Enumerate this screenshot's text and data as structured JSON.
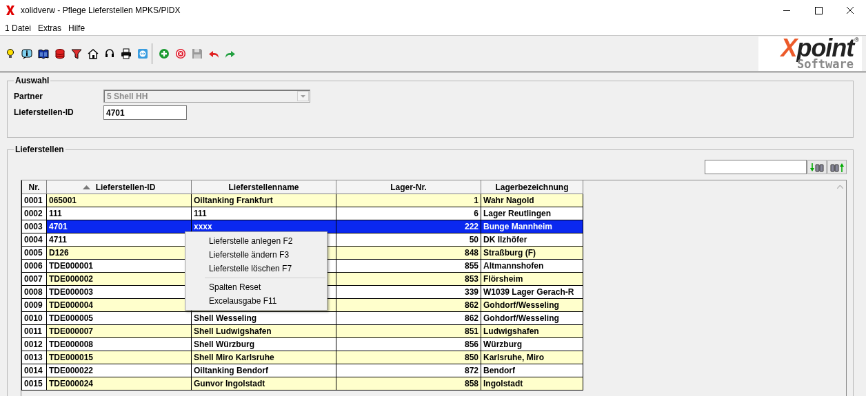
{
  "window": {
    "title": "xolidverw - Pflege Lieferstellen MPKS/PIDX"
  },
  "menu": [
    "1 Datei",
    "Extras",
    "Hilfe"
  ],
  "logo": {
    "text": "Xpoint",
    "subtext": "Software",
    "mark": "®"
  },
  "selection": {
    "title": "Auswahl",
    "partner_label": "Partner",
    "partner_value": "5  Shell HH",
    "partner_disabled": true,
    "id_label": "Lieferstellen-ID",
    "id_value": "4701"
  },
  "list": {
    "title": "Lieferstellen"
  },
  "table": {
    "columns": [
      {
        "label": "Nr.",
        "sorted": false
      },
      {
        "label": "Lieferstellen-ID",
        "sorted": true
      },
      {
        "label": "Lieferstellenname",
        "sorted": false
      },
      {
        "label": "Lager-Nr.",
        "sorted": false
      },
      {
        "label": "Lagerbezeichnung",
        "sorted": false
      }
    ],
    "rows": [
      {
        "selected": false,
        "cells": [
          "0001",
          "065001",
          "Oiltanking Frankfurt",
          "1",
          "Wahr Nagold"
        ]
      },
      {
        "selected": false,
        "cells": [
          "0002",
          "111",
          "111",
          "6",
          "Lager Reutlingen"
        ]
      },
      {
        "selected": true,
        "cells": [
          "0003",
          "4701",
          "xxxx",
          "222",
          "Bunge Mannheim"
        ]
      },
      {
        "selected": false,
        "cells": [
          "0004",
          "4711",
          null,
          "50",
          "DK Ilzhöfer"
        ]
      },
      {
        "selected": false,
        "cells": [
          "0005",
          "D126",
          null,
          "848",
          "Straßburg (F)"
        ]
      },
      {
        "selected": false,
        "cells": [
          "0006",
          "TDE000001",
          null,
          "855",
          "Altmannshofen"
        ]
      },
      {
        "selected": false,
        "cells": [
          "0007",
          "TDE000002",
          null,
          "853",
          "Flörsheim"
        ]
      },
      {
        "selected": false,
        "cells": [
          "0008",
          "TDE000003",
          null,
          "339",
          "W1039 Lager Gerach-R"
        ]
      },
      {
        "selected": false,
        "cells": [
          "0009",
          "TDE000004",
          null,
          "862",
          "Gohdorf/Wesseling"
        ]
      },
      {
        "selected": false,
        "cells": [
          "0010",
          "TDE000005",
          "Shell Wesseling",
          "862",
          "Gohdorf/Wesseling"
        ]
      },
      {
        "selected": false,
        "cells": [
          "0011",
          "TDE000007",
          "Shell Ludwigshafen",
          "851",
          "Ludwigshafen"
        ]
      },
      {
        "selected": false,
        "cells": [
          "0012",
          "TDE000008",
          "Shell Würzburg",
          "856",
          "Würzburg"
        ]
      },
      {
        "selected": false,
        "cells": [
          "0013",
          "TDE000015",
          "Shell Miro Karlsruhe",
          "850",
          "Karlsruhe, Miro"
        ]
      },
      {
        "selected": false,
        "cells": [
          "0014",
          "TDE000022",
          "Oiltanking Bendorf",
          "872",
          "Bendorf"
        ]
      },
      {
        "selected": false,
        "cells": [
          "0015",
          "TDE000024",
          "Gunvor Ingolstadt",
          "858",
          "Ingolstadt"
        ]
      }
    ]
  },
  "context_menu": {
    "items": [
      {
        "kind": "item",
        "label": "Lieferstelle anlegen F2"
      },
      {
        "kind": "item",
        "label": "Lieferstelle ändern F3"
      },
      {
        "kind": "item",
        "label": "Lieferstelle löschen F7"
      },
      {
        "kind": "separator"
      },
      {
        "kind": "item",
        "label": "Spalten Reset"
      },
      {
        "kind": "item",
        "label": "Excelausgabe F11"
      }
    ]
  }
}
